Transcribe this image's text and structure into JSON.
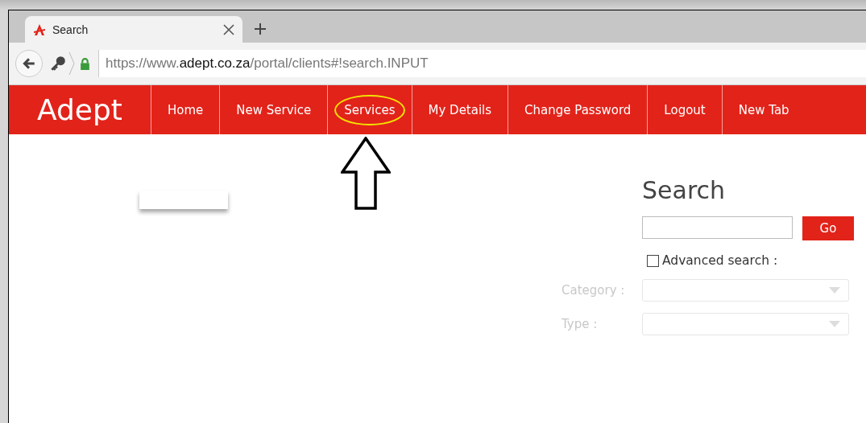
{
  "browser": {
    "tab_title": "Search",
    "url": {
      "scheme": "https://www.",
      "host": "adept.co.za",
      "path": "/portal/clients#!search.INPUT"
    }
  },
  "nav": {
    "logo": "Adept",
    "items": [
      {
        "label": "Home",
        "circled": false
      },
      {
        "label": "New Service",
        "circled": false
      },
      {
        "label": "Services",
        "circled": true
      },
      {
        "label": "My Details",
        "circled": false
      },
      {
        "label": "Change Password",
        "circled": false
      },
      {
        "label": "Logout",
        "circled": false
      },
      {
        "label": "New Tab",
        "circled": false
      }
    ]
  },
  "search": {
    "title": "Search",
    "button": "Go",
    "advanced": {
      "label": "Advanced search :",
      "checked": false
    },
    "filters": [
      {
        "label": "Category :",
        "disabled": true
      },
      {
        "label": "Type :",
        "disabled": true
      }
    ]
  }
}
